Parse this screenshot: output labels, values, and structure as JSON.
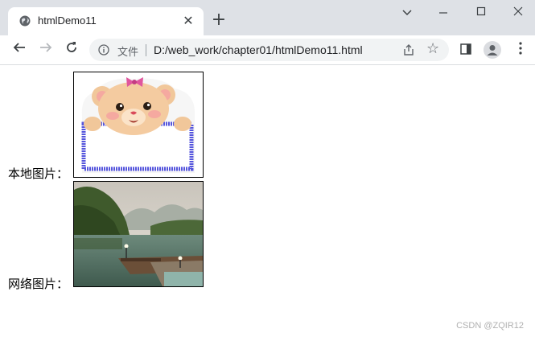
{
  "browser": {
    "tab_title": "htmlDemo11",
    "address_label": "文件",
    "url": "D:/web_work/chapter01/htmlDemo11.html"
  },
  "page": {
    "local_image_label": "本地图片：",
    "web_image_label": "网络图片："
  },
  "watermark": "CSDN @ZQIR12"
}
